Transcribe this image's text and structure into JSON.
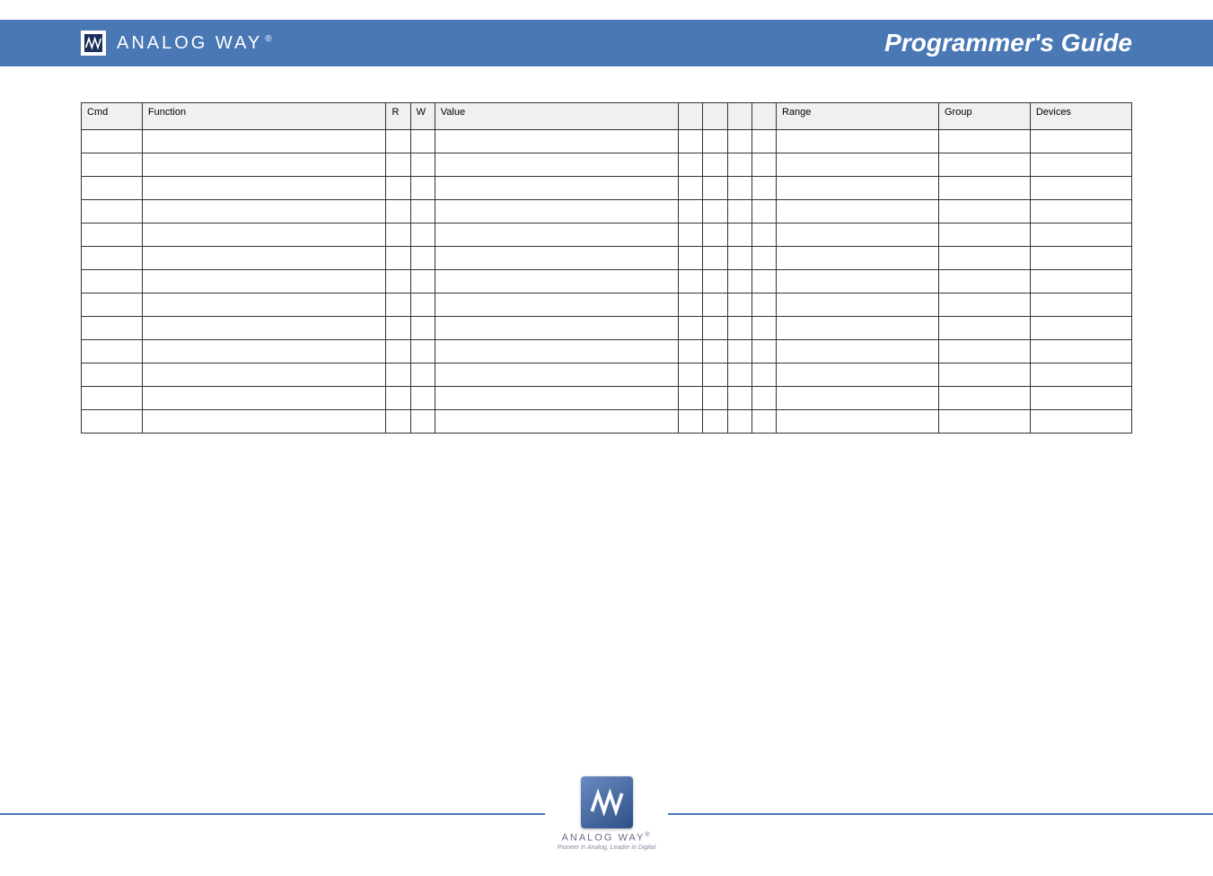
{
  "header": {
    "brand": "ANALOG WAY",
    "title": "Programmer's Guide"
  },
  "table": {
    "headers": [
      "Cmd",
      "Function",
      "R",
      "W",
      "Value",
      "",
      "",
      "",
      "",
      "Range",
      "Group",
      "Devices"
    ],
    "rows": [
      {
        "cmd": "",
        "func": "",
        "r": "",
        "w": "",
        "val": "",
        "d0": "",
        "d1": "",
        "d2": "",
        "d3": "",
        "range": "",
        "group": "",
        "dev": "",
        "cls": "multirow-top"
      },
      {
        "cmd": "",
        "func": "",
        "r": "",
        "w": "",
        "val": "",
        "d0": "",
        "d1": "",
        "d2": "",
        "d3": "",
        "range": "",
        "group": "",
        "dev": "",
        "cls": "multirow-mid"
      },
      {
        "cmd": "",
        "func": "",
        "r": "",
        "w": "",
        "val": "",
        "d0": "",
        "d1": "",
        "d2": "",
        "d3": "",
        "range": "",
        "group": "",
        "dev": "",
        "cls": "multirow-mid"
      },
      {
        "cmd": "",
        "func": "",
        "r": "",
        "w": "",
        "val": "",
        "d0": "",
        "d1": "",
        "d2": "",
        "d3": "",
        "range": "",
        "group": "",
        "dev": "",
        "cls": "multirow-mid"
      },
      {
        "cmd": "",
        "func": "",
        "r": "",
        "w": "",
        "val": "",
        "d0": "",
        "d1": "",
        "d2": "",
        "d3": "",
        "range": "",
        "group": "",
        "dev": "",
        "cls": "multirow-mid"
      },
      {
        "cmd": "",
        "func": "",
        "r": "",
        "w": "",
        "val": "",
        "d0": "",
        "d1": "",
        "d2": "",
        "d3": "",
        "range": "",
        "group": "",
        "dev": "",
        "cls": "multirow-mid"
      },
      {
        "cmd": "",
        "func": "",
        "r": "",
        "w": "",
        "val": "",
        "d0": "",
        "d1": "",
        "d2": "",
        "d3": "",
        "range": "",
        "group": "",
        "dev": "",
        "cls": "multirow-mid"
      },
      {
        "cmd": "",
        "func": "",
        "r": "",
        "w": "",
        "val": "",
        "d0": "",
        "d1": "",
        "d2": "",
        "d3": "",
        "range": "",
        "group": "",
        "dev": "",
        "cls": "multirow-mid"
      },
      {
        "cmd": "",
        "func": "",
        "r": "",
        "w": "",
        "val": "",
        "d0": "",
        "d1": "",
        "d2": "",
        "d3": "",
        "range": "",
        "group": "",
        "dev": "",
        "cls": "multirow-mid"
      },
      {
        "cmd": "",
        "func": "",
        "r": "",
        "w": "",
        "val": "",
        "d0": "",
        "d1": "",
        "d2": "",
        "d3": "",
        "range": "",
        "group": "",
        "dev": "",
        "cls": "multirow-mid"
      },
      {
        "cmd": "",
        "func": "",
        "r": "",
        "w": "",
        "val": "",
        "d0": "",
        "d1": "",
        "d2": "",
        "d3": "",
        "range": "",
        "group": "",
        "dev": "",
        "cls": "multirow-mid"
      },
      {
        "cmd": "",
        "func": "",
        "r": "",
        "w": "",
        "val": "",
        "d0": "",
        "d1": "",
        "d2": "",
        "d3": "",
        "range": "",
        "group": "",
        "dev": "",
        "cls": "multirow-mid"
      },
      {
        "cmd": "",
        "func": "",
        "r": "",
        "w": "",
        "val": "",
        "d0": "",
        "d1": "",
        "d2": "",
        "d3": "",
        "range": "",
        "group": "",
        "dev": "",
        "cls": "multirow-bot"
      }
    ]
  },
  "footer": {
    "brand": "ANALOG WAY",
    "tagline": "Pioneer in Analog, Leader in Digital"
  }
}
